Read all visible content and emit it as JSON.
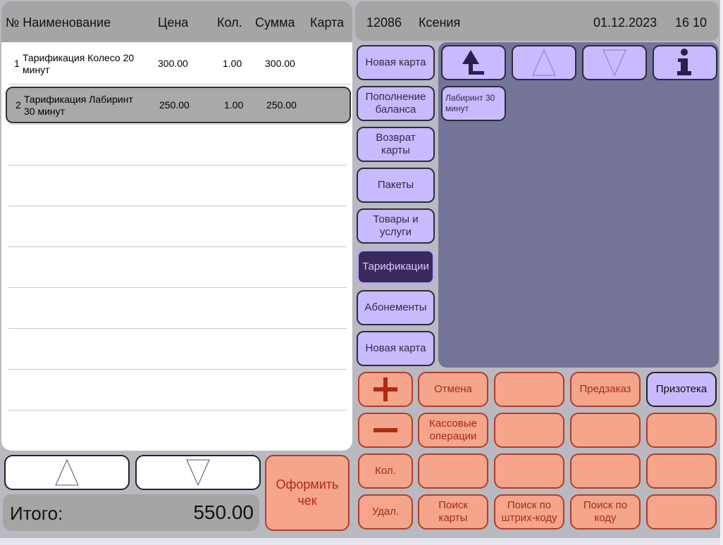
{
  "table": {
    "headers": {
      "num_name": "№ Наименование",
      "price": "Цена",
      "qty": "Кол.",
      "sum": "Сумма",
      "card": "Карта"
    },
    "rows": [
      {
        "num": "1",
        "name": "Тарификация Колесо 20 минут",
        "price": "300.00",
        "qty": "1.00",
        "sum": "300.00",
        "card": ""
      },
      {
        "num": "2",
        "name": "Тарификация Лабиринт 30 минут",
        "price": "250.00",
        "qty": "1.00",
        "sum": "250.00",
        "card": ""
      }
    ]
  },
  "totals": {
    "label": "Итого:",
    "value": "550.00"
  },
  "checkout_label": "Оформить чек",
  "header": {
    "code": "12086",
    "user": "Ксения",
    "date": "01.12.2023",
    "time": "16 10"
  },
  "categories": [
    "Новая карта",
    "Пополнение баланса",
    "Возврат карты",
    "Пакеты",
    "Товары и услуги",
    "Тарификации",
    "Абонементы",
    "Новая карта"
  ],
  "active_category": "Тарификации",
  "products": [
    "Лабиринт 30 минут"
  ],
  "keypad": {
    "row1": [
      "+",
      "Отмена",
      "",
      "Предзаказ",
      "Призотека"
    ],
    "row2": [
      "−",
      "Кассовые операции",
      "",
      "",
      ""
    ],
    "row3": [
      "Кол.",
      "",
      "",
      "",
      ""
    ],
    "row4": [
      "Удал.",
      "Поиск карты",
      "Поиск по штрих-коду",
      "Поиск по коду",
      ""
    ]
  },
  "colors": {
    "category": "#c9b9ff",
    "active_category": "#3a2a5c",
    "key": "#f4a58c",
    "key_border": "#b43d23",
    "product_area": "#737498"
  }
}
